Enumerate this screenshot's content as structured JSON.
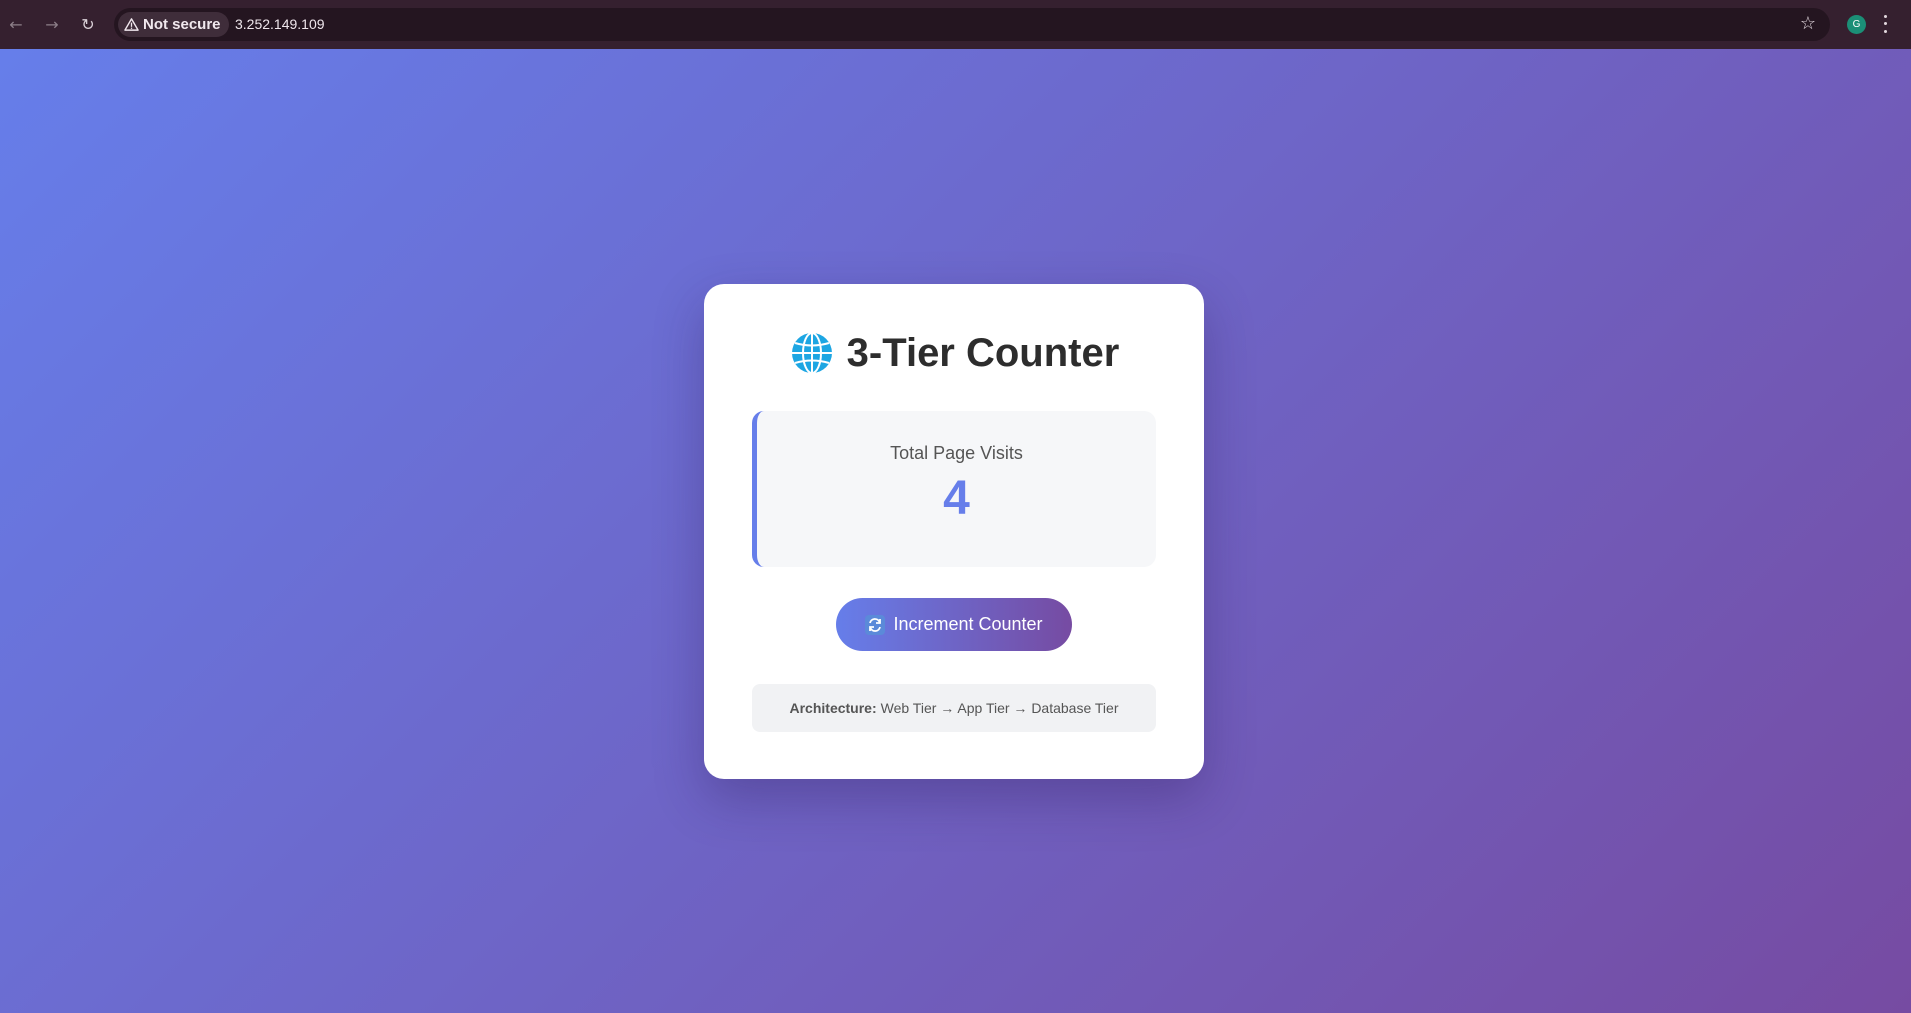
{
  "browser": {
    "security_label": "Not secure",
    "url": "3.252.149.109",
    "profile_initial": "G"
  },
  "icons": {
    "back": "arrow-left",
    "forward": "arrow-right",
    "reload": "reload",
    "security": "warning-triangle",
    "bookmark": "star",
    "menu": "vertical-dots",
    "title": "globe",
    "button": "counterclockwise-arrows"
  },
  "colors": {
    "gradient_start": "#667eea",
    "gradient_end": "#764ba2",
    "counter_accent": "#667eea"
  },
  "card": {
    "title": "3-Tier Counter",
    "stat_label": "Total Page Visits",
    "stat_value": "4",
    "button_label": "Increment Counter",
    "architecture_label": "Architecture:",
    "architecture_text": "Web Tier → App Tier → Database Tier"
  }
}
